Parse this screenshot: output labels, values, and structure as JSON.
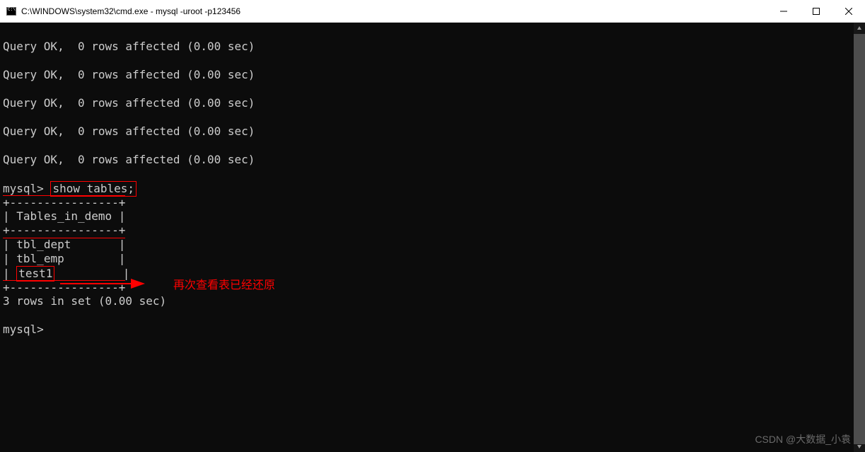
{
  "window": {
    "title": "C:\\WINDOWS\\system32\\cmd.exe - mysql  -uroot -p123456"
  },
  "terminal": {
    "query_ok_lines": [
      "Query OK,  0 rows affected (0.00 sec)",
      "Query OK,  0 rows affected (0.00 sec)",
      "Query OK,  0 rows affected (0.00 sec)",
      "Query OK,  0 rows affected (0.00 sec)",
      "Query OK,  0 rows affected (0.00 sec)"
    ],
    "prompt": "mysql>",
    "command": "show tables;",
    "table_header": "Tables_in_demo",
    "table_rows": [
      "tbl_dept",
      "tbl_emp",
      "test1"
    ],
    "result_summary": "3 rows in set (0.00 sec)",
    "dash_separator_top": "+----------------+",
    "dash_separator_pipe": "|",
    "final_prompt": "mysql>"
  },
  "annotation": {
    "text": "再次查看表已经还原"
  },
  "watermark": {
    "text": "CSDN @大数据_小袁"
  }
}
